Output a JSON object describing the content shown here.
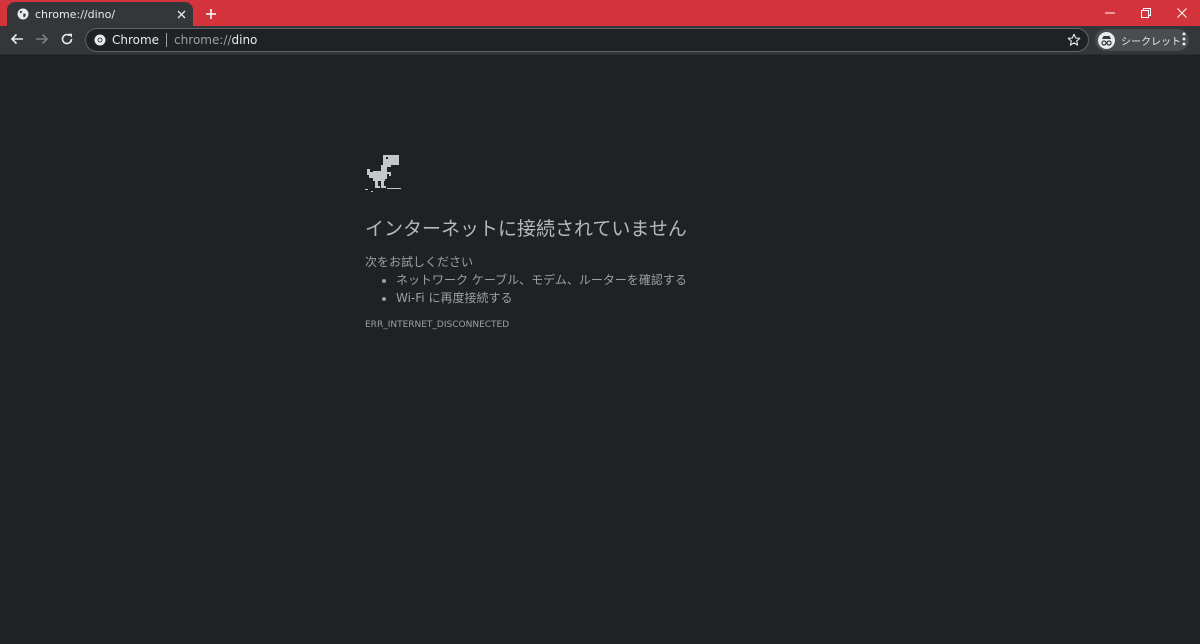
{
  "colors": {
    "titlebar": "#d3333a",
    "toolbar": "#35363a",
    "page_background": "#202124",
    "text_primary": "#e8eaed",
    "text_secondary": "#9aa0a6"
  },
  "tab": {
    "favicon": "globe-icon",
    "title": "chrome://dino/",
    "close_icon": "close-icon"
  },
  "new_tab_icon": "plus-icon",
  "window_controls": [
    "minimize-icon",
    "restore-icon",
    "close-icon"
  ],
  "nav": {
    "back_icon": "arrow-left-icon",
    "forward_icon": "arrow-right-icon",
    "reload_icon": "reload-icon"
  },
  "omnibox": {
    "chip_icon": "chrome-icon",
    "site_name": "Chrome",
    "url_scheme": "chrome://",
    "url_host": "dino",
    "bookmark_icon": "star-icon"
  },
  "profile": {
    "icon": "incognito-icon",
    "label": "シークレット"
  },
  "menu_icon": "kebab-menu-icon",
  "page": {
    "dino_icon": "dino-icon",
    "title": "インターネットに接続されていません",
    "suggestions_heading": "次をお試しください",
    "suggestions": [
      "ネットワーク ケーブル、モデム、ルーターを確認する",
      "Wi-Fi に再度接続する"
    ],
    "error_code": "ERR_INTERNET_DISCONNECTED"
  }
}
